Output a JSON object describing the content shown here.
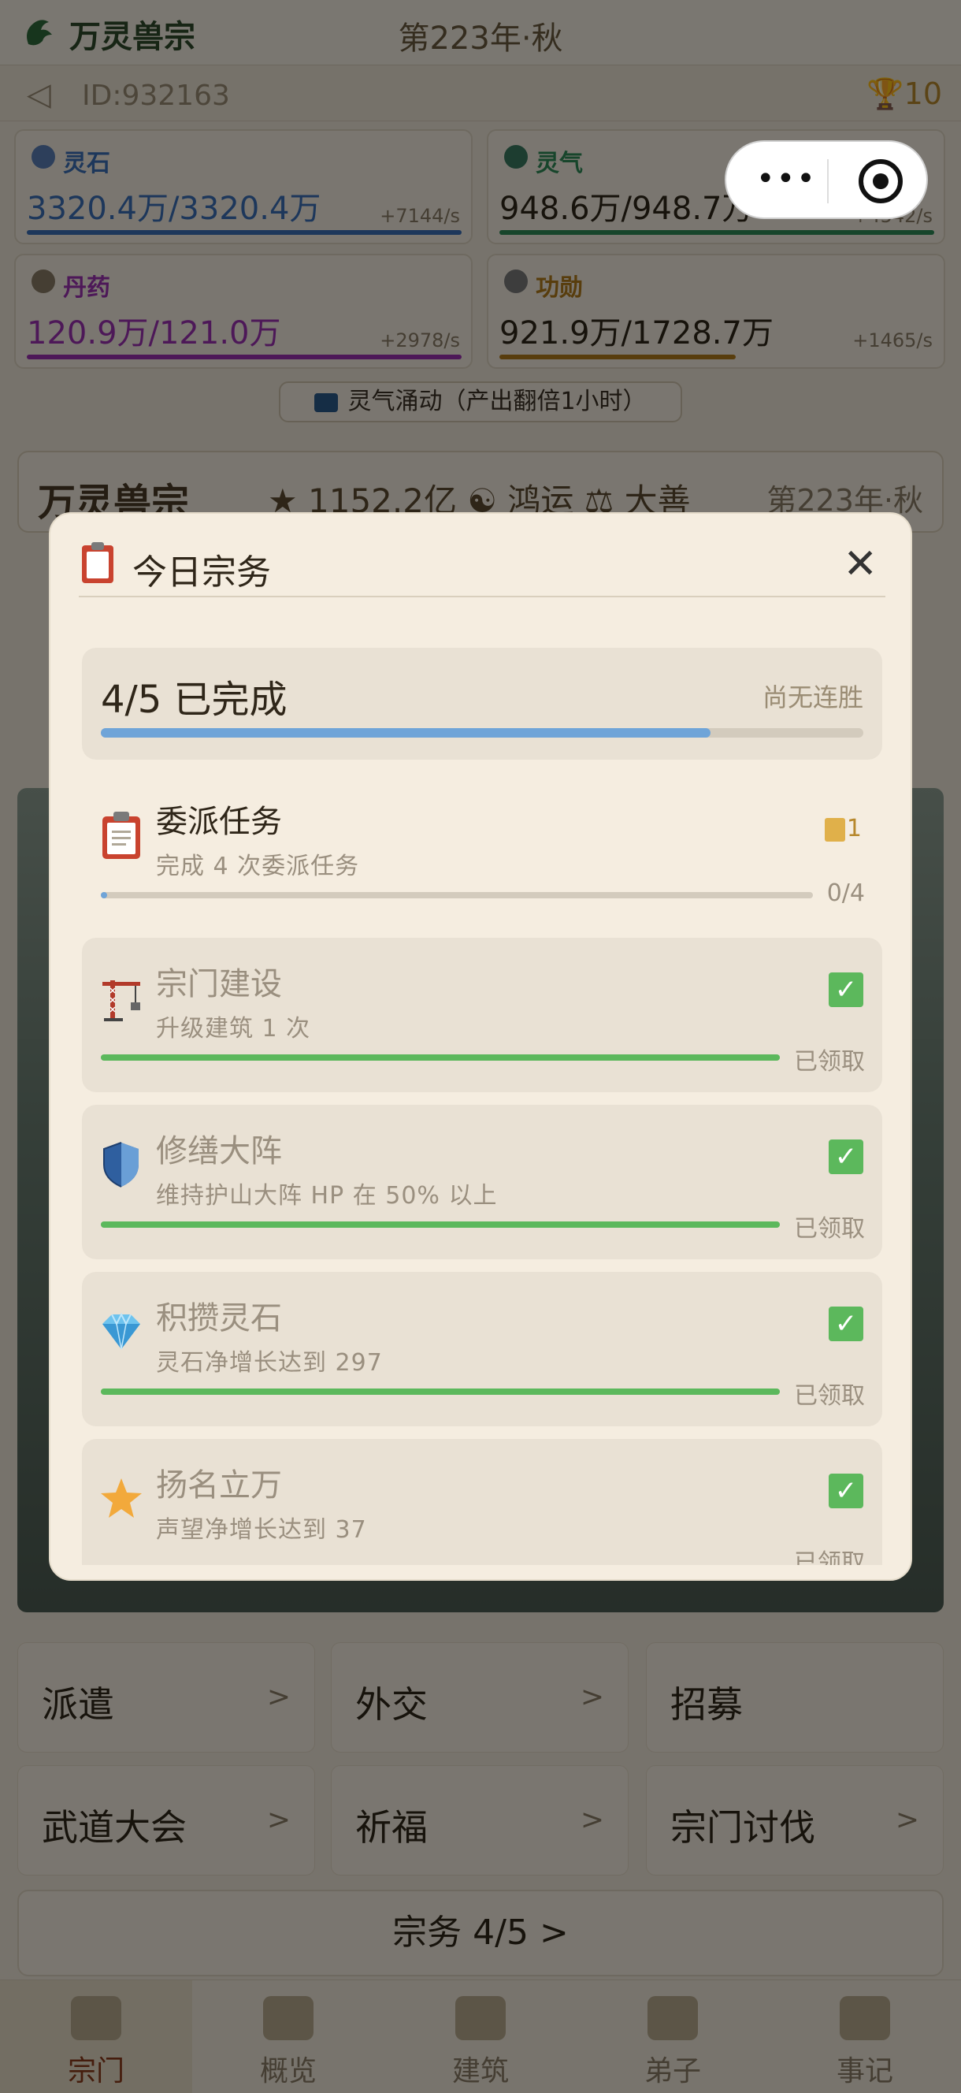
{
  "header": {
    "app_title": "万灵兽宗",
    "season": "第223年·秋",
    "player_id": "ID:932163",
    "trophy_count": "10"
  },
  "resources": [
    {
      "name": "灵石",
      "value": "3320.4万/3320.4万",
      "rate": "+7144/s",
      "color": "#3b6fb6"
    },
    {
      "name": "灵气",
      "value": "948.6万/948.7万",
      "rate": "+4542/s",
      "color": "#2e8b57"
    },
    {
      "name": "丹药",
      "value": "120.9万/121.0万",
      "rate": "+2978/s",
      "color": "#9b30b0"
    },
    {
      "name": "功勋",
      "value": "921.9万/1728.7万",
      "rate": "+1465/s",
      "color": "#b07a1a"
    }
  ],
  "boost_button": "灵气涌动（产出翻倍1小时）",
  "sect_banner": {
    "name": "万灵兽宗",
    "stats": "★ 1152.2亿 ☯ 鸿运 ⚖ 大善",
    "season": "第223年·秋"
  },
  "actions": [
    {
      "label": "派遣",
      "arrow": ">"
    },
    {
      "label": "外交",
      "arrow": ">"
    },
    {
      "label": "招募",
      "arrow": ""
    },
    {
      "label": "武道大会",
      "arrow": ">"
    },
    {
      "label": "祈福",
      "arrow": ">"
    },
    {
      "label": "宗门讨伐",
      "arrow": ">"
    }
  ],
  "quest_button": "宗务 4/5 >",
  "bottom_nav": [
    {
      "label": "宗门"
    },
    {
      "label": "概览"
    },
    {
      "label": "建筑"
    },
    {
      "label": "弟子"
    },
    {
      "label": "事记"
    }
  ],
  "capsule": {
    "more": "•••"
  },
  "modal": {
    "title": "今日宗务",
    "close": "✕",
    "progress": {
      "count_text": "4/5 已完成",
      "streak_text": "尚无连胜",
      "fraction": 0.8
    },
    "tasks": [
      {
        "title": "委派任务",
        "desc": "完成 4 次委派任务",
        "status": "0/4",
        "reward": "1",
        "done": false,
        "progress": 0.0
      },
      {
        "title": "宗门建设",
        "desc": "升级建筑 1 次",
        "status": "已领取",
        "done": true,
        "progress": 1.0
      },
      {
        "title": "修缮大阵",
        "desc": "维持护山大阵 HP 在 50% 以上",
        "status": "已领取",
        "done": true,
        "progress": 1.0
      },
      {
        "title": "积攒灵石",
        "desc": "灵石净增长达到 297",
        "status": "已领取",
        "done": true,
        "progress": 1.0
      },
      {
        "title": "扬名立万",
        "desc": "声望净增长达到 37",
        "status": "已领取",
        "done": true,
        "progress": 1.0
      }
    ],
    "check_mark": "✓",
    "icons": [
      "clipboard-icon",
      "crane-icon",
      "shield-icon",
      "diamond-icon",
      "star-icon"
    ],
    "accent_colors": {
      "progress_blue": "#6fa4d8",
      "task_green": "#5cb85c"
    }
  }
}
